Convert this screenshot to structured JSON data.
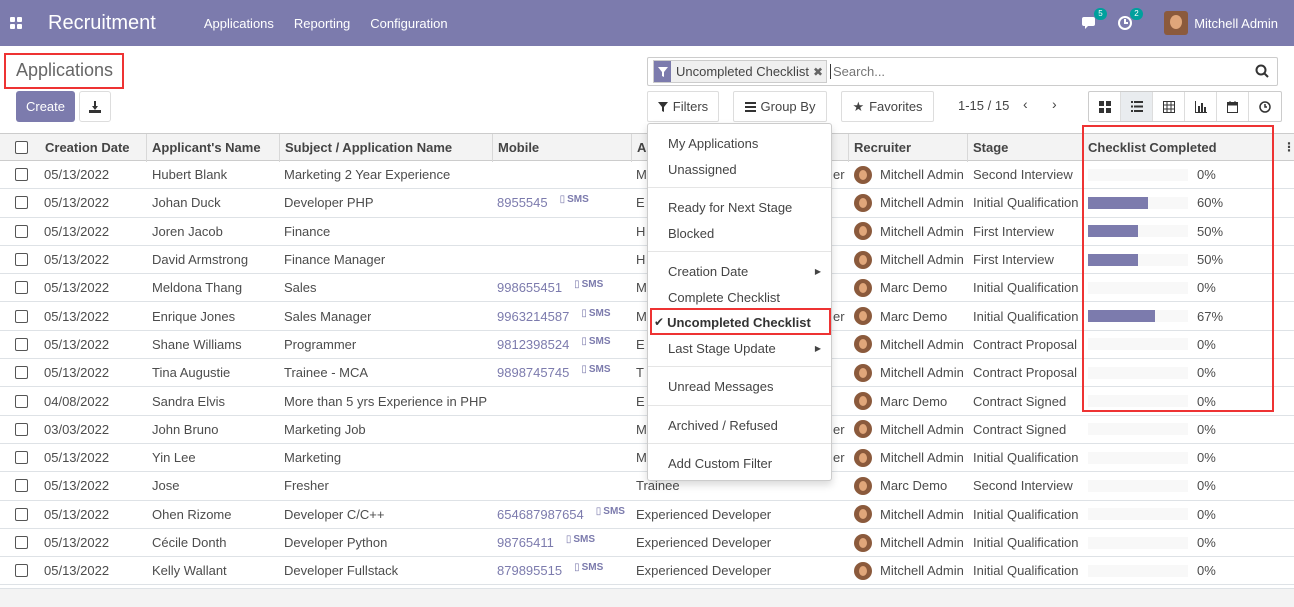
{
  "navbar": {
    "app_title": "Recruitment",
    "menu": [
      "Applications",
      "Reporting",
      "Configuration"
    ],
    "messages_count": "5",
    "activities_count": "2",
    "user_name": "Mitchell Admin"
  },
  "control_panel": {
    "title": "Applications",
    "create_label": "Create",
    "search": {
      "facet_label": "Uncompleted Checklist",
      "placeholder": "Search..."
    },
    "filters_label": "Filters",
    "groupby_label": "Group By",
    "favorites_label": "Favorites",
    "pager": "1-15 / 15"
  },
  "table": {
    "headers": [
      "Creation Date",
      "Applicant's Name",
      "Subject / Application Name",
      "Mobile",
      "A",
      "Recruiter",
      "Stage",
      "Checklist Completed"
    ],
    "rows": [
      {
        "date": "05/13/2022",
        "name": "Hubert Blank",
        "subject": "Marketing 2 Year Experience",
        "mobile": "",
        "sms": "",
        "applied": "M",
        "applied_tail": "er",
        "recruiter": "Mitchell Admin",
        "stage": "Second Interview",
        "progress": 0,
        "pct": "0%"
      },
      {
        "date": "05/13/2022",
        "name": "Johan Duck",
        "subject": "Developer PHP",
        "mobile": "8955545",
        "sms": "SMS",
        "applied": "E",
        "applied_tail": "",
        "recruiter": "Mitchell Admin",
        "stage": "Initial Qualification",
        "progress": 60,
        "pct": "60%"
      },
      {
        "date": "05/13/2022",
        "name": "Joren Jacob",
        "subject": "Finance",
        "mobile": "",
        "sms": "",
        "applied": "H",
        "applied_tail": "",
        "recruiter": "Mitchell Admin",
        "stage": "First Interview",
        "progress": 50,
        "pct": "50%"
      },
      {
        "date": "05/13/2022",
        "name": "David Armstrong",
        "subject": "Finance Manager",
        "mobile": "",
        "sms": "",
        "applied": "H",
        "applied_tail": "",
        "recruiter": "Mitchell Admin",
        "stage": "First Interview",
        "progress": 50,
        "pct": "50%"
      },
      {
        "date": "05/13/2022",
        "name": "Meldona Thang",
        "subject": "Sales",
        "mobile": "998655451",
        "sms": "SMS",
        "applied": "M",
        "applied_tail": "",
        "recruiter": "Marc Demo",
        "stage": "Initial Qualification",
        "progress": 0,
        "pct": "0%"
      },
      {
        "date": "05/13/2022",
        "name": "Enrique Jones",
        "subject": "Sales Manager",
        "mobile": "9963214587",
        "sms": "SMS",
        "applied": "M",
        "applied_tail": "er",
        "recruiter": "Marc Demo",
        "stage": "Initial Qualification",
        "progress": 67,
        "pct": "67%"
      },
      {
        "date": "05/13/2022",
        "name": "Shane Williams",
        "subject": "Programmer",
        "mobile": "9812398524",
        "sms": "SMS",
        "applied": "E",
        "applied_tail": "",
        "recruiter": "Mitchell Admin",
        "stage": "Contract Proposal",
        "progress": 0,
        "pct": "0%"
      },
      {
        "date": "05/13/2022",
        "name": "Tina Augustie",
        "subject": "Trainee - MCA",
        "mobile": "9898745745",
        "sms": "SMS",
        "applied": "T",
        "applied_tail": "",
        "recruiter": "Mitchell Admin",
        "stage": "Contract Proposal",
        "progress": 0,
        "pct": "0%"
      },
      {
        "date": "04/08/2022",
        "name": "Sandra Elvis",
        "subject": "More than 5 yrs Experience in PHP",
        "mobile": "",
        "sms": "",
        "applied": "E",
        "applied_tail": "",
        "recruiter": "Marc Demo",
        "stage": "Contract Signed",
        "progress": 0,
        "pct": "0%"
      },
      {
        "date": "03/03/2022",
        "name": "John Bruno",
        "subject": "Marketing Job",
        "mobile": "",
        "sms": "",
        "applied": "M",
        "applied_tail": "er",
        "recruiter": "Mitchell Admin",
        "stage": "Contract Signed",
        "progress": 0,
        "pct": "0%"
      },
      {
        "date": "05/13/2022",
        "name": "Yin Lee",
        "subject": "Marketing",
        "mobile": "",
        "sms": "",
        "applied": "M",
        "applied_tail": "er",
        "recruiter": "Mitchell Admin",
        "stage": "Initial Qualification",
        "progress": 0,
        "pct": "0%"
      },
      {
        "date": "05/13/2022",
        "name": "Jose",
        "subject": "Fresher",
        "mobile": "",
        "sms": "",
        "applied": "Trainee",
        "applied_tail": "",
        "recruiter": "Marc Demo",
        "stage": "Second Interview",
        "progress": 0,
        "pct": "0%"
      },
      {
        "date": "05/13/2022",
        "name": "Ohen Rizome",
        "subject": "Developer C/C++",
        "mobile": "654687987654",
        "sms": "SMS",
        "applied": "Experienced Developer",
        "applied_tail": "",
        "recruiter": "Mitchell Admin",
        "stage": "Initial Qualification",
        "progress": 0,
        "pct": "0%"
      },
      {
        "date": "05/13/2022",
        "name": "Cécile Donth",
        "subject": "Developer Python",
        "mobile": "98765411",
        "sms": "SMS",
        "applied": "Experienced Developer",
        "applied_tail": "",
        "recruiter": "Mitchell Admin",
        "stage": "Initial Qualification",
        "progress": 0,
        "pct": "0%"
      },
      {
        "date": "05/13/2022",
        "name": "Kelly Wallant",
        "subject": "Developer Fullstack",
        "mobile": "879895515",
        "sms": "SMS",
        "applied": "Experienced Developer",
        "applied_tail": "",
        "recruiter": "Mitchell Admin",
        "stage": "Initial Qualification",
        "progress": 0,
        "pct": "0%"
      }
    ]
  },
  "filters_dropdown": {
    "items": [
      {
        "label": "My Applications"
      },
      {
        "label": "Unassigned"
      },
      {
        "label": "Ready for Next Stage"
      },
      {
        "label": "Blocked"
      },
      {
        "label": "Creation Date",
        "caret": true
      },
      {
        "label": "Complete Checklist"
      },
      {
        "label": "Uncompleted Checklist",
        "checked": true
      },
      {
        "label": "Last Stage Update",
        "caret": true
      },
      {
        "label": "Unread Messages"
      },
      {
        "label": "Archived / Refused"
      },
      {
        "label": "Add Custom Filter"
      }
    ]
  },
  "colors": {
    "brand": "#7c7bad",
    "highlight": "#ee3333"
  }
}
